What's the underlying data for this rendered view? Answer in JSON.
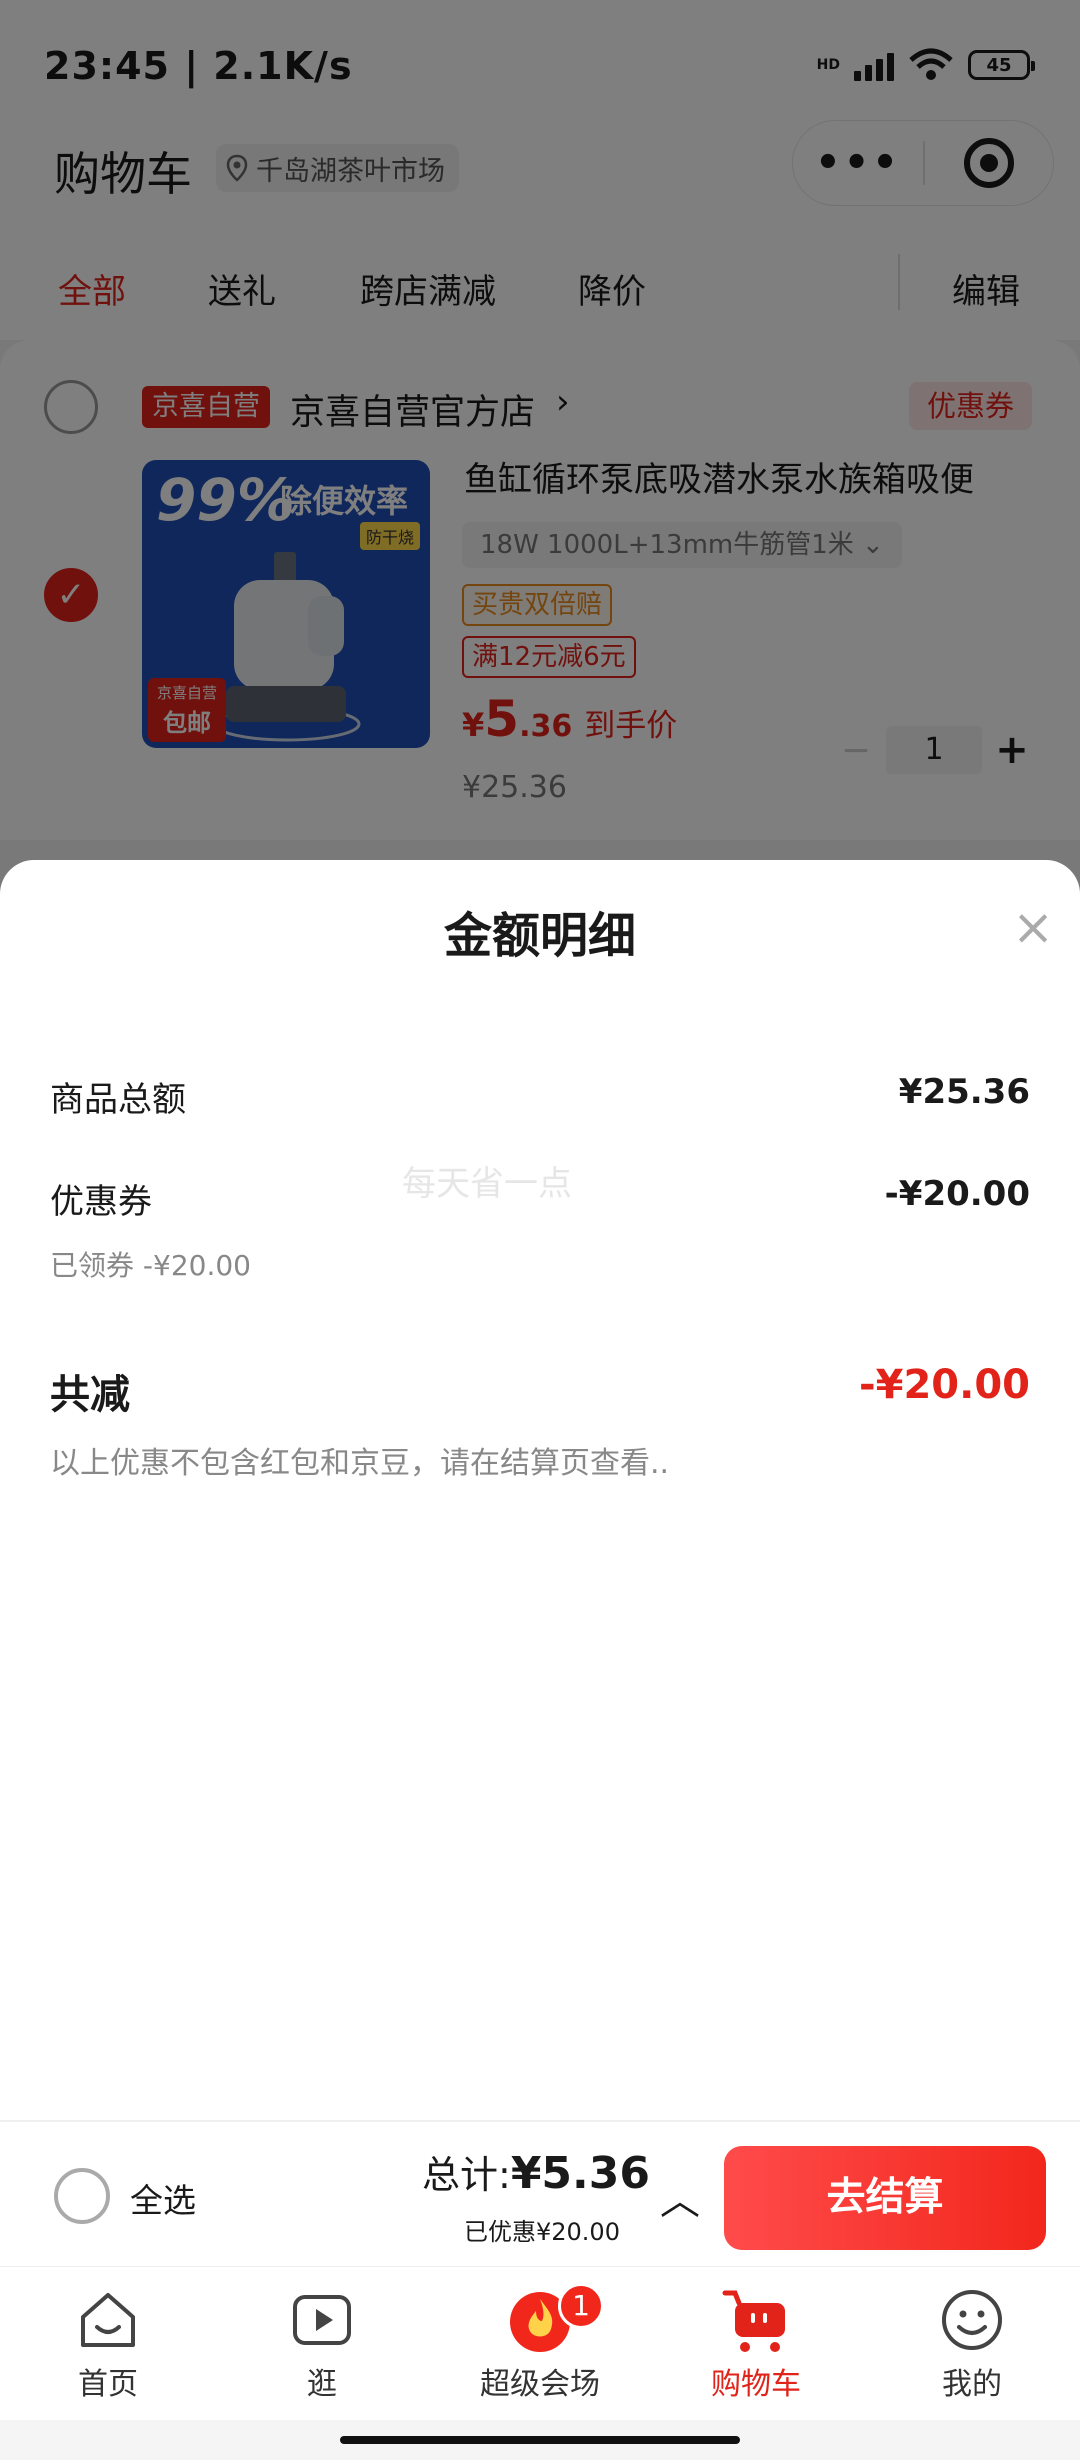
{
  "status_bar": {
    "time": "23:45 | 2.1K/s",
    "hd": "HD",
    "battery": "45"
  },
  "header": {
    "title": "购物车",
    "location": "千岛湖茶叶市场",
    "menu_dots": "•••"
  },
  "tabs": [
    "全部",
    "送礼",
    "跨店满减",
    "降价"
  ],
  "tabs_edit": "编辑",
  "shop": {
    "badge": "京喜自营",
    "name": "京喜自营官方店",
    "arrow": "›",
    "coupon": "优惠券"
  },
  "product": {
    "image_text": {
      "big": "99%",
      "headline": "除便效率",
      "sub": "防干烧",
      "corner_top": "京喜自营",
      "corner_bottom": "包邮"
    },
    "title": "鱼缸循环泵底吸潜水泵水族箱吸便",
    "spec": "18W 1000L+13mm牛筋管1米 ⌄",
    "tag1": "买贵双倍赔",
    "tag2": "满12元减6元",
    "price_symbol": "¥",
    "price_int": "5",
    "price_dec": ".36",
    "price_label": "到手价",
    "original_price": "¥25.36",
    "quantity": "1",
    "minus": "−",
    "plus": "+"
  },
  "sheet": {
    "title": "金额明细",
    "close": "×",
    "rows": [
      {
        "label": "商品总额",
        "value": "¥25.36"
      },
      {
        "label": "优惠券",
        "value": "-¥20.00",
        "sub": "已领券 -¥20.00"
      }
    ],
    "watermark": "每天省一点",
    "total_label": "共减",
    "total_value": "-¥20.00",
    "note": "以上优惠不包含红包和京豆，请在结算页查看.."
  },
  "checkout": {
    "select_all": "全选",
    "total_label": "总计:",
    "total_value": "¥5.36",
    "saved": "已优惠¥20.00",
    "expand": "︿",
    "button": "去结算"
  },
  "tabbar": [
    {
      "label": "首页",
      "icon": "home-icon"
    },
    {
      "label": "逛",
      "icon": "play-icon"
    },
    {
      "label": "超级会场",
      "icon": "flame-icon",
      "badge": "1"
    },
    {
      "label": "购物车",
      "icon": "cart-icon"
    },
    {
      "label": "我的",
      "icon": "smile-icon"
    }
  ],
  "colors": {
    "accent": "#e2231a",
    "overlay": "rgba(0,0,0,0.5)"
  }
}
